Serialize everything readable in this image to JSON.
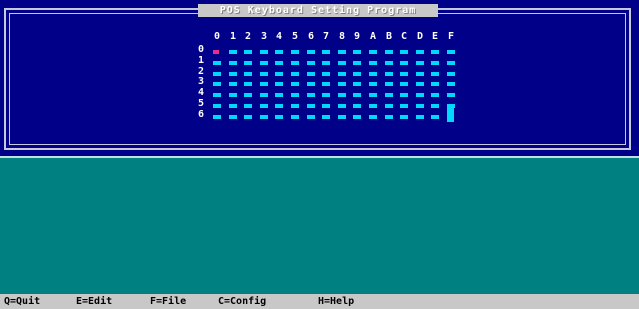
{
  "window": {
    "title": "POS Keyboard Setting Program"
  },
  "grid": {
    "columns": [
      "0",
      "1",
      "2",
      "3",
      "4",
      "5",
      "6",
      "7",
      "8",
      "9",
      "A",
      "B",
      "C",
      "D",
      "E",
      "F"
    ],
    "rows": [
      "0",
      "1",
      "2",
      "3",
      "4",
      "5",
      "6"
    ],
    "selected_cell": "0,0"
  },
  "status_bar": {
    "commands": [
      "Q=Quit",
      "E=Edit",
      "F=File",
      "C=Config",
      "H=Help"
    ]
  },
  "colors": {
    "top_panel": "#000088",
    "work_area": "#008080",
    "key_cell": "#00d8ff",
    "cursor": "#e0308a",
    "status_bar": "#c8c8c8"
  }
}
